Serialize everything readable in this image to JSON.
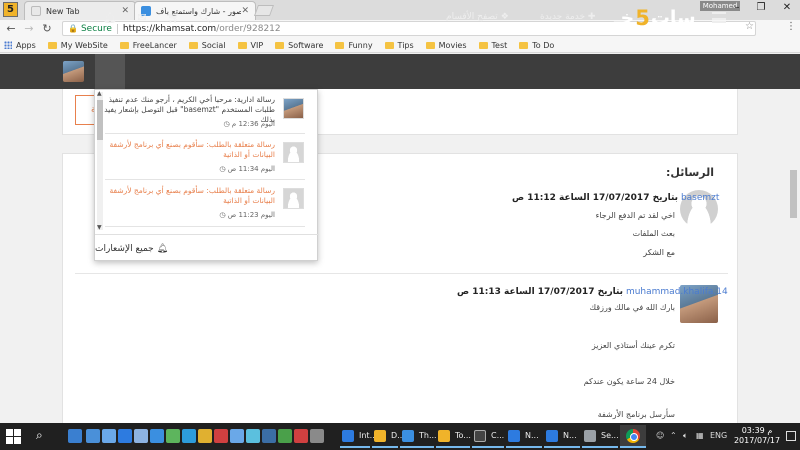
{
  "browser": {
    "app_badge": "5",
    "tabs": [
      {
        "label": "New Tab",
        "active": false
      },
      {
        "label": "صور - شارك واستمتع بأف…",
        "active": true
      }
    ],
    "user_label": "Mohamed",
    "security_label": "Secure",
    "url_host": "https://khamsat.com",
    "url_path": "/order/928212",
    "bookmarks": [
      "Apps",
      "My WebSite",
      "FreeLancer",
      "Social",
      "VIP",
      "Software",
      "Funny",
      "Tips",
      "Movies",
      "Test",
      "To Do"
    ]
  },
  "site": {
    "logo_prefix": "خـ",
    "logo_mark": "5",
    "logo_suffix": "سات",
    "nav_new_service": "خدمة جديدة",
    "nav_browse": "تصفح الأقسام",
    "accent_color": "#f0b32a",
    "orange_color": "#e8804d"
  },
  "notifications": {
    "items": [
      {
        "text": "رسالة ادارية: مرحبا أخي الكريم ، أرجو منك عدم تنفيذ طلبات المستخدم \"basemzt\" قبل التوصل بإشعار يفيد بذلك",
        "time": "اليوم 12:36 م",
        "avatar": "photo",
        "color": "dark"
      },
      {
        "text": "رسالة متعلقة بالطلب: سأقوم بصنع أي برنامج لأرشفة البيانات أو الذاتية",
        "time": "اليوم 11:34 ص",
        "avatar": "grey",
        "color": "orange"
      },
      {
        "text": "رسالة متعلقة بالطلب: سأقوم بصنع أي برنامج لأرشفة البيانات أو الذاتية",
        "time": "اليوم 11:23 ص",
        "avatar": "grey",
        "color": "orange"
      }
    ],
    "footer_label": "جميع الإشعارات"
  },
  "order": {
    "button_label": "الة"
  },
  "messages": {
    "title": "الرسائل:",
    "list": [
      {
        "user": "basemzt",
        "date": "بتاريخ 17/07/2017 الساعة 11:12 ص",
        "lines": [
          "اخي لقد تم الدفع الرجاء",
          "بعث الملفات",
          "مع الشكر"
        ],
        "avatar": "grey"
      },
      {
        "user": "muhammad.khalifa.14",
        "date": "بتاريخ 17/07/2017 الساعة 11:13 ص",
        "lines": [
          "بارك الله في مالك ورزقك",
          "تكرم عينك أستاذي العزيز",
          "خلال 24 ساعة يكون عندكم",
          "سأرسل برنامج الأرشفة"
        ],
        "avatar": "photo"
      }
    ]
  },
  "taskbar": {
    "apps": [
      "Int...",
      "D...",
      "Th...",
      "To...",
      "C...",
      "N...",
      "N...",
      "Se..."
    ],
    "language": "ENG",
    "time": "03:39 م",
    "date": "2017/07/17"
  }
}
